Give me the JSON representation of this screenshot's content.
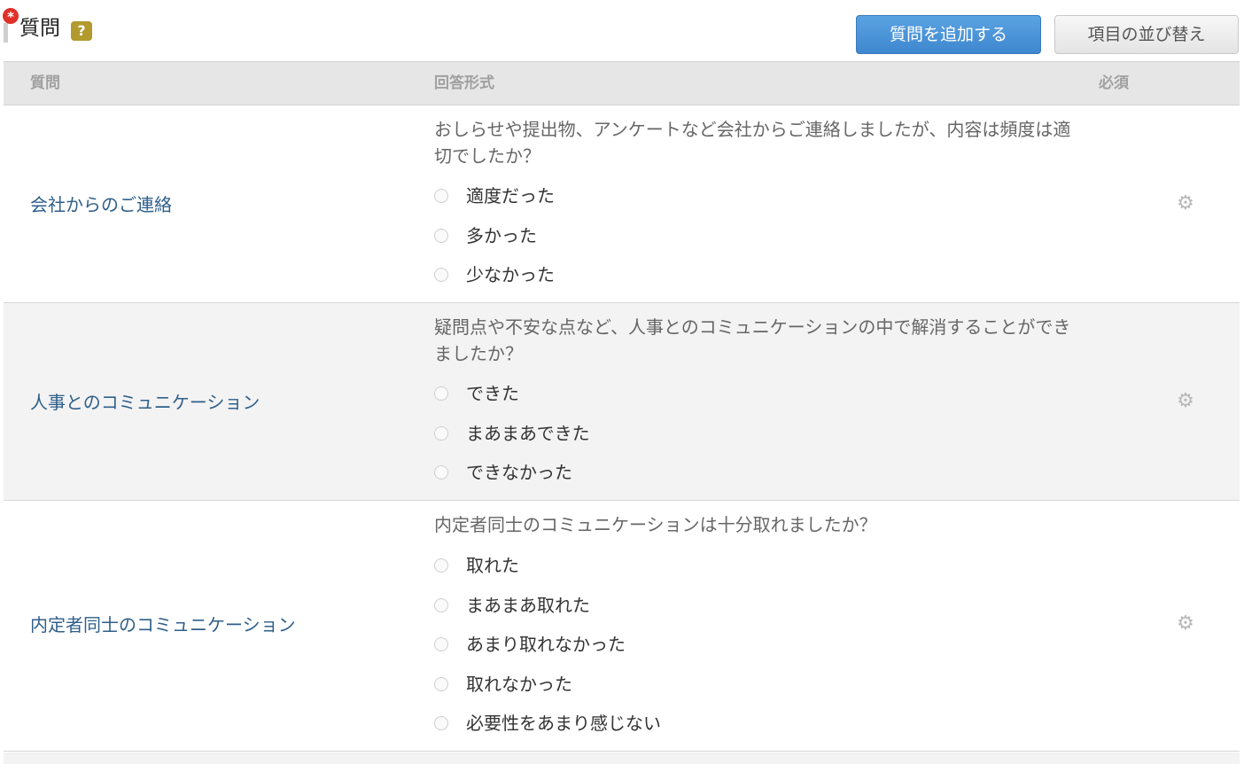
{
  "header": {
    "title": "質問",
    "required_mark": "*",
    "help_mark": "?",
    "add_button": "質問を追加する",
    "reorder_button": "項目の並び替え"
  },
  "table": {
    "columns": {
      "question": "質問",
      "format": "回答形式",
      "required": "必須"
    },
    "rows": [
      {
        "label": "会社からのご連絡",
        "question_text": "おしらせや提出物、アンケートなど会社からご連絡しましたが、内容は頻度は適切でしたか？",
        "options": [
          "適度だった",
          "多かった",
          "少なかった"
        ]
      },
      {
        "label": "人事とのコミュニケーション",
        "question_text": "疑問点や不安な点など、人事とのコミュニケーションの中で解消することができましたか？",
        "options": [
          "できた",
          "まあまあできた",
          "できなかった"
        ]
      },
      {
        "label": "内定者同士のコミュニケーション",
        "question_text": "内定者同士のコミュニケーションは十分取れましたか？",
        "options": [
          "取れた",
          "まあまあ取れた",
          "あまり取れなかった",
          "取れなかった",
          "必要性をあまり感じない"
        ]
      }
    ]
  },
  "icons": {
    "settings": "gear-icon",
    "help": "question-mark-icon",
    "required": "asterisk-badge-icon",
    "radio": "radio-button-icon"
  },
  "colors": {
    "primary_button": "#4a92d8",
    "link": "#2f5f8a",
    "required_badge": "#e0302a",
    "help_badge": "#b39a2c",
    "header_bg": "#e6e6e6",
    "alt_row_bg": "#f3f3f3"
  }
}
